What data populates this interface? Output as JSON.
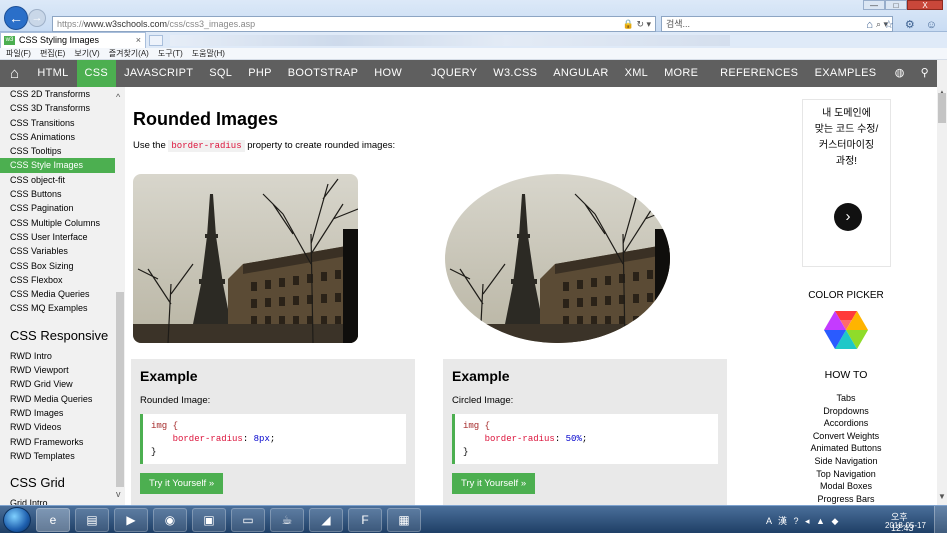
{
  "browser": {
    "url_prefix": "https://",
    "url_host": "www.w3schools.com",
    "url_path": "/css/css3_images.asp",
    "search_placeholder": "검색...",
    "tab_title": "CSS Styling Images",
    "tab_close": "×",
    "window_controls": {
      "minimize": "—",
      "maximize": "□",
      "close": "X"
    },
    "tools_icons": "⌂ ☆ ⚙ ☺"
  },
  "menubar": {
    "items": [
      "파일(F)",
      "편집(E)",
      "보기(V)",
      "즐겨찾기(A)",
      "도구(T)",
      "도움말(H)"
    ]
  },
  "topnav": {
    "home_icon": "home-icon",
    "items": [
      "HTML",
      "CSS",
      "JAVASCRIPT",
      "SQL",
      "PHP",
      "BOOTSTRAP",
      "HOW TO",
      "JQUERY",
      "W3.CSS",
      "ANGULAR",
      "XML",
      "MORE"
    ],
    "active_index": 1,
    "references": "REFERENCES",
    "examples": "EXAMPLES",
    "caret": "▼"
  },
  "sidebar": {
    "group1": [
      "CSS 2D Transforms",
      "CSS 3D Transforms",
      "CSS Transitions",
      "CSS Animations",
      "CSS Tooltips",
      "CSS Style Images",
      "CSS object-fit",
      "CSS Buttons",
      "CSS Pagination",
      "CSS Multiple Columns",
      "CSS User Interface",
      "CSS Variables",
      "CSS Box Sizing",
      "CSS Flexbox",
      "CSS Media Queries",
      "CSS MQ Examples"
    ],
    "active_item": "CSS Style Images",
    "heading2": "CSS Responsive",
    "group2": [
      "RWD Intro",
      "RWD Viewport",
      "RWD Grid View",
      "RWD Media Queries",
      "RWD Images",
      "RWD Videos",
      "RWD Frameworks",
      "RWD Templates"
    ],
    "heading3": "CSS Grid",
    "group3": [
      "Grid Intro"
    ]
  },
  "main": {
    "title": "Rounded Images",
    "intro_before": "Use the ",
    "intro_code": "border-radius",
    "intro_after": " property to create rounded images:",
    "examples": [
      {
        "heading": "Example",
        "subtitle": "Rounded Image:",
        "code_selector": "img {",
        "code_property": "border-radius",
        "code_value": "8px",
        "code_close": "}",
        "button": "Try it Yourself »"
      },
      {
        "heading": "Example",
        "subtitle": "Circled Image:",
        "code_selector": "img {",
        "code_property": "border-radius",
        "code_value": "50%",
        "code_close": "}",
        "button": "Try it Yourself »"
      }
    ]
  },
  "rightcol": {
    "ad_line1": "내 도메인에",
    "ad_line2": "맞는 코드 수정/",
    "ad_line3": "커스터마이징",
    "ad_line4": "과정!",
    "ad_button": "›",
    "colorpicker": "COLOR PICKER",
    "howto_heading": "HOW TO",
    "howto_items": [
      "Tabs",
      "Dropdowns",
      "Accordions",
      "Convert Weights",
      "Animated Buttons",
      "Side Navigation",
      "Top Navigation",
      "Modal Boxes",
      "Progress Bars"
    ]
  },
  "taskbar": {
    "apps": [
      "ie-icon",
      "explorer-icon",
      "media-player-icon",
      "chrome-icon",
      "app-icon",
      "cmd-icon",
      "java-icon",
      "vscode-icon",
      "filezilla-icon",
      "notepad-icon"
    ],
    "tray_lang": "A 漢",
    "time": "오후 12:43",
    "date": "2018-05-17"
  }
}
